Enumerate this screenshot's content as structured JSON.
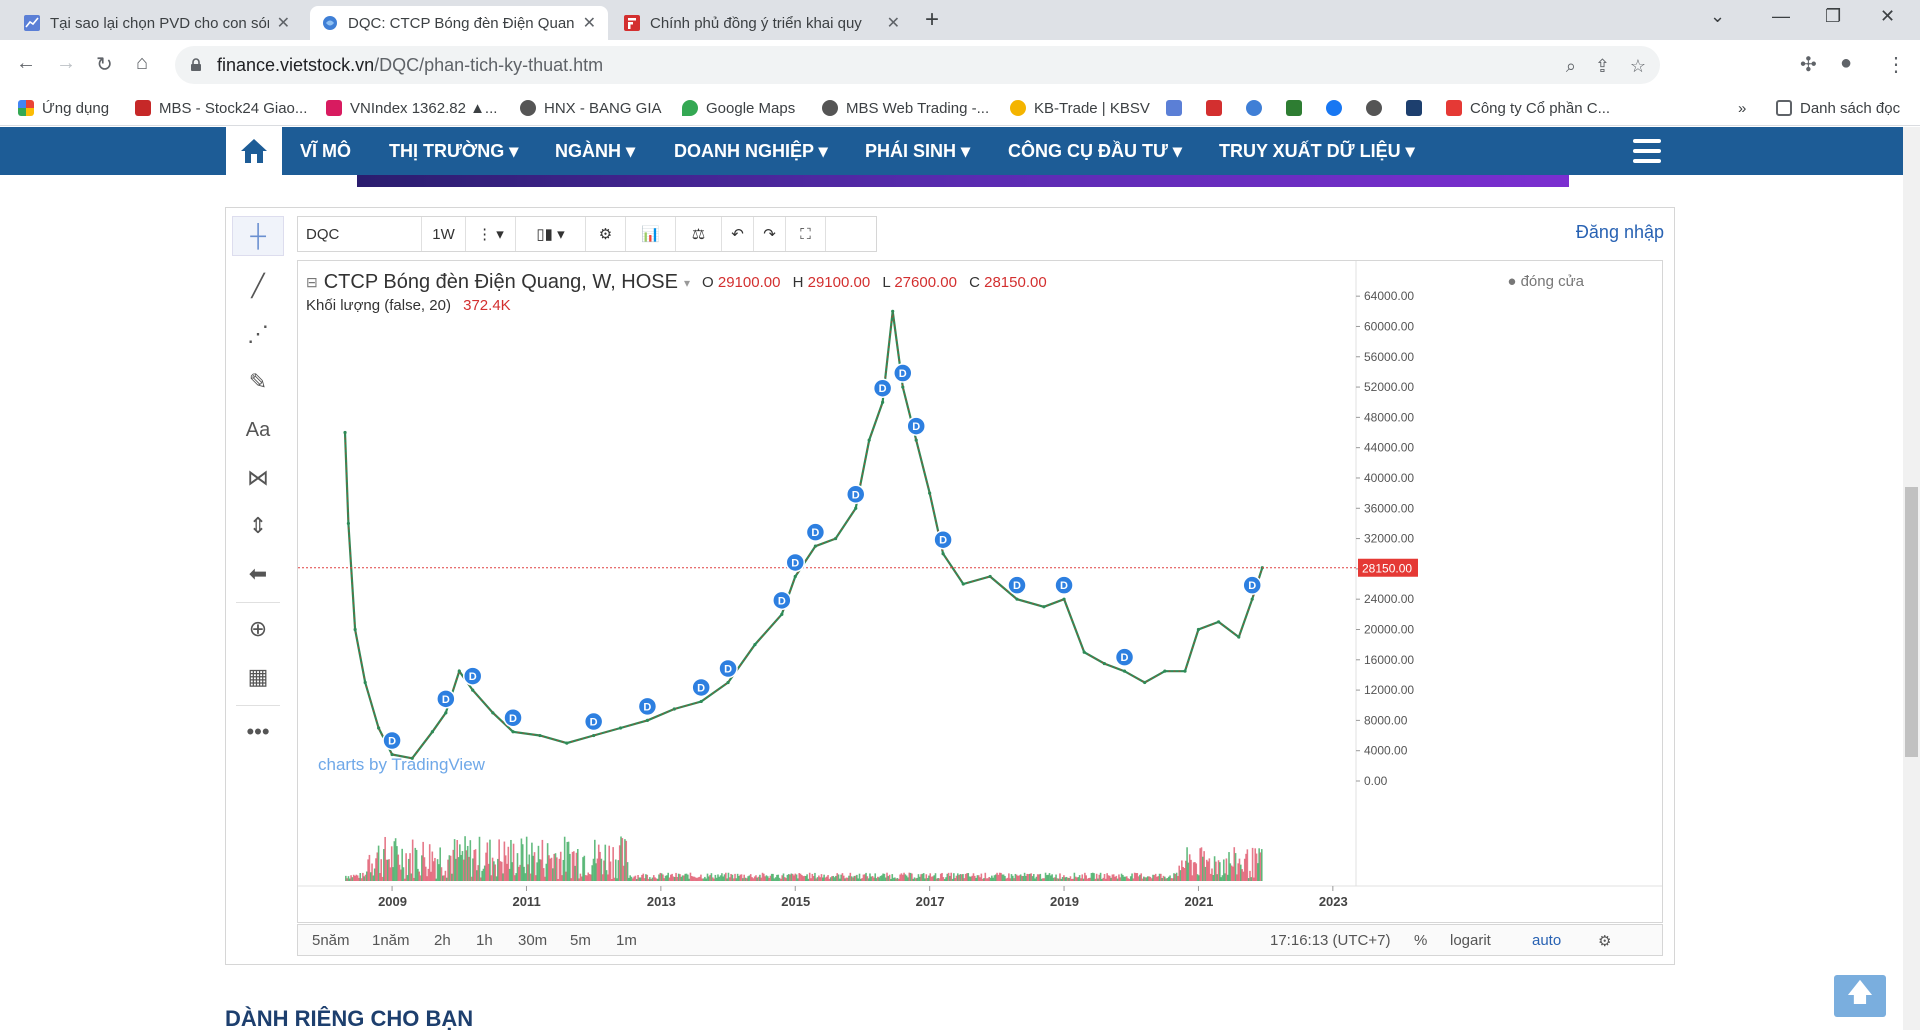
{
  "browser": {
    "tabs": [
      {
        "label": "Tại sao lại chọn PVD cho con sóng",
        "active": false
      },
      {
        "label": "DQC: CTCP Bóng đèn Điện Quang",
        "active": true
      },
      {
        "label": "Chính phủ đồng ý triển khai quy",
        "active": false
      }
    ],
    "url_host": "finance.vietstock.vn",
    "url_path": "/DQC/phan-tich-ky-thuat.htm"
  },
  "bookmarks": [
    {
      "label": "Ứng dụng",
      "color": "#4285f4"
    },
    {
      "label": "MBS - Stock24 Giao...",
      "color": "#c62828"
    },
    {
      "label": "VNIndex 1362.82 ▲...",
      "color": "#d81b60"
    },
    {
      "label": "HNX - BANG GIA",
      "color": "#555555"
    },
    {
      "label": "Google Maps",
      "color": "#34a853"
    },
    {
      "label": "MBS Web Trading -...",
      "color": "#555555"
    },
    {
      "label": "KB-Trade | KBSV",
      "color": "#f4b400"
    },
    {
      "label": "Công ty Cổ phần C...",
      "color": "#e53935"
    },
    {
      "label": "Danh sách đọc",
      "color": "#5f6368"
    }
  ],
  "site_nav": {
    "items": [
      "VĨ MÔ",
      "THỊ TRƯỜNG ▾",
      "NGÀNH ▾",
      "DOANH NGHIỆP ▾",
      "PHÁI SINH ▾",
      "CÔNG CỤ ĐẦU TƯ ▾",
      "TRUY XUẤT DỮ LIỆU ▾"
    ]
  },
  "chart_toolbar": {
    "symbol": "DQC",
    "interval": "1W",
    "login": "Đăng nhập"
  },
  "legend": {
    "title": "CTCP Bóng đèn Điện Quang, W, HOSE",
    "o_label": "O",
    "o": "29100.00",
    "h_label": "H",
    "h": "29100.00",
    "l_label": "L",
    "l": "27600.00",
    "c_label": "C",
    "c": "28150.00",
    "volume_label": "Khối lượng (false, 20)",
    "volume": "372.4K",
    "close_label": "● đóng cửa",
    "watermark": "charts by TradingView"
  },
  "chart_data": {
    "type": "line",
    "title": "CTCP Bóng đèn Điện Quang, W, HOSE",
    "x_ticks": [
      "2009",
      "2011",
      "2013",
      "2015",
      "2017",
      "2019",
      "2021",
      "2023"
    ],
    "y_ticks": [
      "64000.00",
      "60000.00",
      "56000.00",
      "52000.00",
      "48000.00",
      "44000.00",
      "40000.00",
      "36000.00",
      "32000.00",
      "28000.00",
      "24000.00",
      "20000.00",
      "16000.00",
      "12000.00",
      "8000.00",
      "4000.00",
      "0.00"
    ],
    "ylim": [
      0,
      66000
    ],
    "x": [
      2008.3,
      2008.35,
      2008.45,
      2008.6,
      2008.8,
      2009.0,
      2009.3,
      2009.6,
      2009.8,
      2010.0,
      2010.2,
      2010.5,
      2010.8,
      2011.2,
      2011.6,
      2012.0,
      2012.4,
      2012.8,
      2013.2,
      2013.6,
      2014.0,
      2014.4,
      2014.8,
      2015.0,
      2015.3,
      2015.6,
      2015.9,
      2016.1,
      2016.3,
      2016.45,
      2016.6,
      2016.8,
      2017.0,
      2017.2,
      2017.5,
      2017.9,
      2018.3,
      2018.7,
      2019.0,
      2019.3,
      2019.6,
      2019.9,
      2020.2,
      2020.5,
      2020.8,
      2021.0,
      2021.3,
      2021.6,
      2021.8,
      2021.95
    ],
    "series": [
      {
        "values": [
          46000,
          34000,
          20000,
          13000,
          7000,
          3500,
          3000,
          6500,
          9000,
          14500,
          12000,
          9000,
          6500,
          6000,
          5000,
          6000,
          7000,
          8000,
          9500,
          10500,
          13000,
          18000,
          22000,
          27000,
          31000,
          32000,
          36000,
          45000,
          50000,
          62000,
          52000,
          45000,
          38000,
          30000,
          26000,
          27000,
          24000,
          23000,
          24000,
          17000,
          15500,
          14500,
          13000,
          14500,
          14500,
          20000,
          21000,
          19000,
          24000,
          28150
        ]
      }
    ],
    "last_price_label": "28150.00",
    "dividend_marker_label": "D"
  },
  "bottom_bar": {
    "ranges": [
      "5năm",
      "1năm",
      "2h",
      "1h",
      "30m",
      "5m",
      "1m"
    ],
    "time": "17:16:13 (UTC+7)",
    "percent": "%",
    "log": "logarit",
    "auto": "auto"
  },
  "section_title": "DÀNH RIÊNG CHO BẠN"
}
